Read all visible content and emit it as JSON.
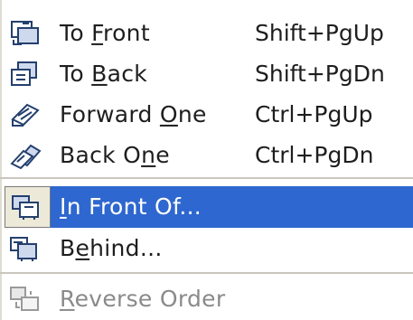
{
  "menu": {
    "items": [
      {
        "label": "To Front",
        "mnemonic": "F",
        "shortcut": "Shift+PgUp",
        "icon": "to-front-icon",
        "state": "normal"
      },
      {
        "label": "To Back",
        "mnemonic": "B",
        "shortcut": "Shift+PgDn",
        "icon": "to-back-icon",
        "state": "normal"
      },
      {
        "label": "Forward One",
        "mnemonic": "O",
        "shortcut": "Ctrl+PgUp",
        "icon": "forward-one-icon",
        "state": "normal"
      },
      {
        "label": "Back One",
        "mnemonic": "n",
        "shortcut": "Ctrl+PgDn",
        "icon": "back-one-icon",
        "state": "normal"
      },
      {
        "label": "In Front Of...",
        "mnemonic": "I",
        "shortcut": "",
        "icon": "in-front-of-icon",
        "state": "selected"
      },
      {
        "label": "Behind...",
        "mnemonic": "e",
        "shortcut": "",
        "icon": "behind-icon",
        "state": "normal"
      },
      {
        "label": "Reverse Order",
        "mnemonic": "R",
        "shortcut": "",
        "icon": "reverse-order-icon",
        "state": "disabled"
      }
    ]
  },
  "colors": {
    "selection_bg": "#2e67cf",
    "selection_text": "#ffffff",
    "text": "#1e1e1e",
    "disabled_text": "#8a8a8a",
    "separator": "#c8c6bd"
  }
}
